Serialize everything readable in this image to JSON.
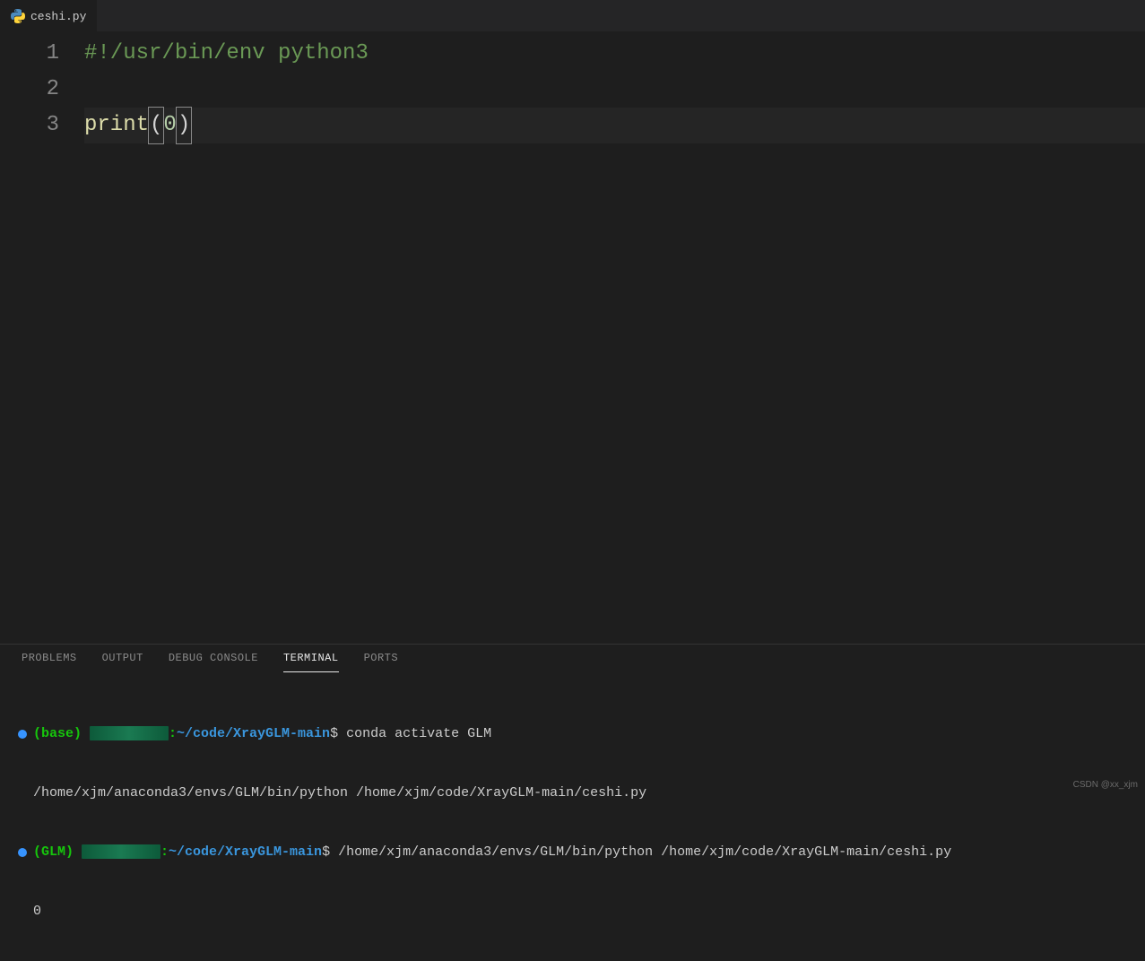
{
  "tab": {
    "filename": "ceshi.py"
  },
  "code": {
    "lines": [
      {
        "num": "1",
        "segments": [
          {
            "cls": "tok-comment",
            "txt": "#!/usr/bin/env python3"
          }
        ]
      },
      {
        "num": "2",
        "segments": []
      },
      {
        "num": "3",
        "highlighted": true,
        "segments": [
          {
            "cls": "tok-func",
            "txt": "print"
          },
          {
            "cls": "tok-paren bracket-box",
            "txt": "("
          },
          {
            "cls": "tok-num",
            "txt": "0"
          },
          {
            "cls": "tok-paren bracket-box",
            "txt": ")"
          }
        ]
      }
    ]
  },
  "panel": {
    "tabs": [
      {
        "label": "PROBLEMS",
        "active": false
      },
      {
        "label": "OUTPUT",
        "active": false
      },
      {
        "label": "DEBUG CONSOLE",
        "active": false
      },
      {
        "label": "TERMINAL",
        "active": true
      },
      {
        "label": "PORTS",
        "active": false
      }
    ]
  },
  "terminal": {
    "prompt1_env": "(base) ",
    "path_part": "~/code/XrayGLM-main",
    "dollar": "$ ",
    "cmd1": "conda activate GLM",
    "line2_path": "/home/xjm/anaconda3/envs/GLM/bin/python /home/xjm/code/XrayGLM-main/ceshi.py",
    "prompt2_env": "(GLM) ",
    "cmd2": "/home/xjm/anaconda3/envs/GLM/bin/python /home/xjm/code/XrayGLM-main/ceshi.py",
    "output": "0",
    "colon": ":"
  },
  "watermark": "CSDN @xx_xjm"
}
